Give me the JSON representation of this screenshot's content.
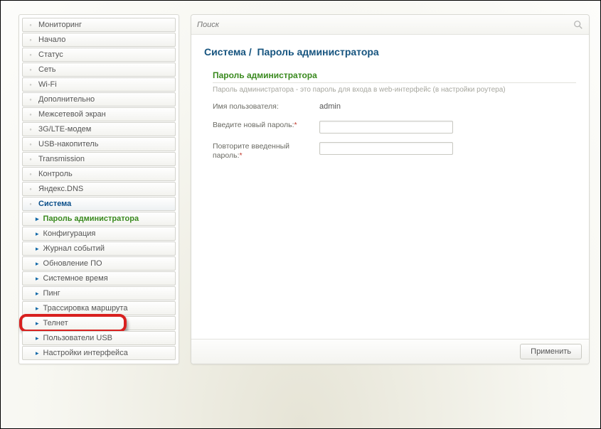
{
  "search": {
    "placeholder": "Поиск"
  },
  "breadcrumb": {
    "section": "Система",
    "sep": "/",
    "page": "Пароль администратора"
  },
  "sidebar": {
    "items": [
      {
        "label": "Мониторинг"
      },
      {
        "label": "Начало"
      },
      {
        "label": "Статус"
      },
      {
        "label": "Сеть"
      },
      {
        "label": "Wi-Fi"
      },
      {
        "label": "Дополнительно"
      },
      {
        "label": "Межсетевой экран"
      },
      {
        "label": "3G/LTE-модем"
      },
      {
        "label": "USB-накопитель"
      },
      {
        "label": "Transmission"
      },
      {
        "label": "Контроль"
      },
      {
        "label": "Яндекс.DNS"
      },
      {
        "label": "Система",
        "active": true
      }
    ],
    "subitems": [
      {
        "label": "Пароль администратора",
        "active": true
      },
      {
        "label": "Конфигурация"
      },
      {
        "label": "Журнал событий"
      },
      {
        "label": "Обновление ПО"
      },
      {
        "label": "Системное время"
      },
      {
        "label": "Пинг"
      },
      {
        "label": "Трассировка маршрута"
      },
      {
        "label": "Телнет",
        "highlight": true
      },
      {
        "label": "Пользователи USB"
      },
      {
        "label": "Настройки интерфейса"
      }
    ]
  },
  "form": {
    "title": "Пароль администратора",
    "desc": "Пароль администратора - это пароль для входа в web-интерфейс (в настройки роутера)",
    "username_label": "Имя пользователя:",
    "username_value": "admin",
    "newpass_label": "Введите новый пароль:",
    "confirm_label": "Повторите введенный пароль:",
    "required_mark": "*"
  },
  "buttons": {
    "apply": "Применить"
  }
}
